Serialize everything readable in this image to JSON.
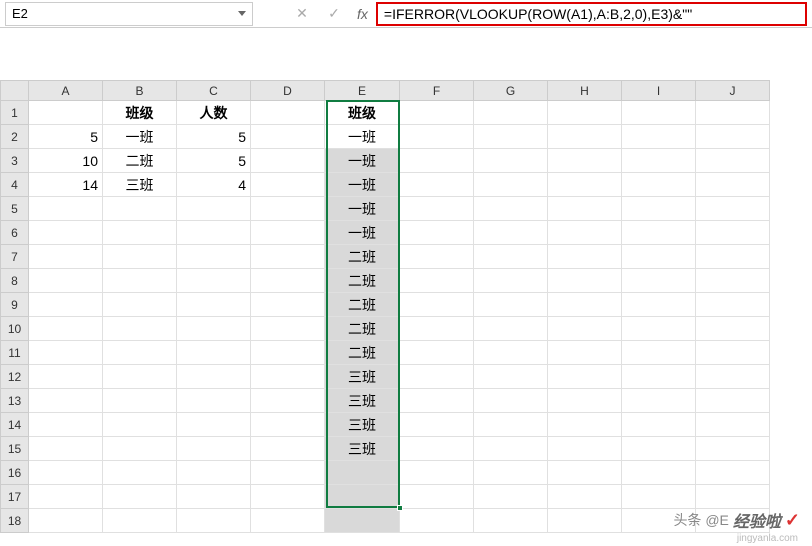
{
  "nameBox": {
    "value": "E2"
  },
  "formula": {
    "value": "=IFERROR(VLOOKUP(ROW(A1),A:B,2,0),E3)&\"\""
  },
  "columns": [
    "A",
    "B",
    "C",
    "D",
    "E",
    "F",
    "G",
    "H",
    "I",
    "J"
  ],
  "rowCount": 18,
  "headers": {
    "B1": "班级",
    "C1": "人数",
    "E1": "班级"
  },
  "data": {
    "A2": "5",
    "A3": "10",
    "A4": "14",
    "B2": "一班",
    "B3": "二班",
    "B4": "三班",
    "C2": "5",
    "C3": "5",
    "C4": "4",
    "E2": "一班",
    "E3": "一班",
    "E4": "一班",
    "E5": "一班",
    "E6": "一班",
    "E7": "二班",
    "E8": "二班",
    "E9": "二班",
    "E10": "二班",
    "E11": "二班",
    "E12": "三班",
    "E13": "三班",
    "E14": "三班",
    "E15": "三班"
  },
  "watermark": {
    "prefix": "头条 @E",
    "brand": "经验啦",
    "site": "jingyanla.com"
  }
}
